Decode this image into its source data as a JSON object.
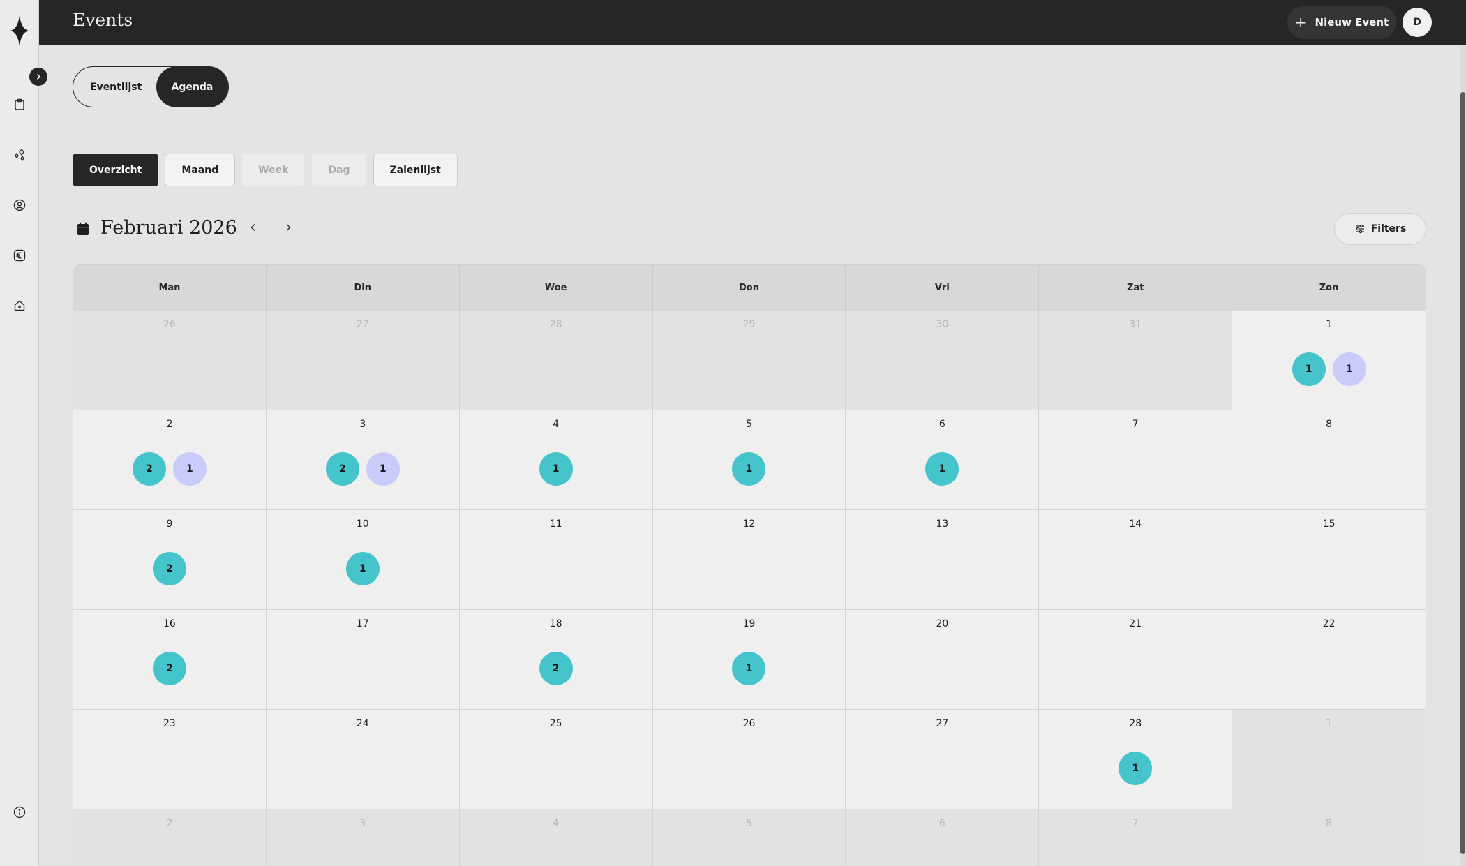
{
  "app": {
    "title": "Events"
  },
  "header": {
    "new_event_label": "Nieuw Event",
    "avatar_initial": "D"
  },
  "sidebar": {
    "items": [
      {
        "icon": "clipboard-icon"
      },
      {
        "icon": "sparkle-diamonds-icon"
      },
      {
        "icon": "user-circle-icon"
      },
      {
        "icon": "euro-icon"
      },
      {
        "icon": "home-icon"
      }
    ],
    "footer_icon": "info-icon"
  },
  "view_toggle": {
    "options": [
      "Eventlijst",
      "Agenda"
    ],
    "active": "Agenda"
  },
  "view_tabs": [
    {
      "label": "Overzicht",
      "state": "active"
    },
    {
      "label": "Maand",
      "state": "normal"
    },
    {
      "label": "Week",
      "state": "disabled"
    },
    {
      "label": "Dag",
      "state": "disabled"
    },
    {
      "label": "Zalenlijst",
      "state": "normal"
    }
  ],
  "calendar": {
    "month_label": "Februari 2026",
    "filters_label": "Filters",
    "weekdays": [
      "Man",
      "Din",
      "Woe",
      "Don",
      "Vri",
      "Zat",
      "Zon"
    ],
    "colors": {
      "teal": "#45c4cb",
      "lavender": "#c9cbf8"
    },
    "weeks": [
      [
        {
          "day": "26",
          "outside": true,
          "badges": []
        },
        {
          "day": "27",
          "outside": true,
          "badges": []
        },
        {
          "day": "28",
          "outside": true,
          "badges": []
        },
        {
          "day": "29",
          "outside": true,
          "badges": []
        },
        {
          "day": "30",
          "outside": true,
          "badges": []
        },
        {
          "day": "31",
          "outside": true,
          "badges": []
        },
        {
          "day": "1",
          "outside": false,
          "badges": [
            {
              "count": "1",
              "color": "teal"
            },
            {
              "count": "1",
              "color": "lavender"
            }
          ]
        }
      ],
      [
        {
          "day": "2",
          "outside": false,
          "badges": [
            {
              "count": "2",
              "color": "teal"
            },
            {
              "count": "1",
              "color": "lavender"
            }
          ]
        },
        {
          "day": "3",
          "outside": false,
          "badges": [
            {
              "count": "2",
              "color": "teal"
            },
            {
              "count": "1",
              "color": "lavender"
            }
          ]
        },
        {
          "day": "4",
          "outside": false,
          "badges": [
            {
              "count": "1",
              "color": "teal"
            }
          ]
        },
        {
          "day": "5",
          "outside": false,
          "badges": [
            {
              "count": "1",
              "color": "teal"
            }
          ]
        },
        {
          "day": "6",
          "outside": false,
          "badges": [
            {
              "count": "1",
              "color": "teal"
            }
          ]
        },
        {
          "day": "7",
          "outside": false,
          "badges": []
        },
        {
          "day": "8",
          "outside": false,
          "badges": []
        }
      ],
      [
        {
          "day": "9",
          "outside": false,
          "badges": [
            {
              "count": "2",
              "color": "teal"
            }
          ]
        },
        {
          "day": "10",
          "outside": false,
          "badges": [
            {
              "count": "1",
              "color": "teal"
            }
          ]
        },
        {
          "day": "11",
          "outside": false,
          "badges": []
        },
        {
          "day": "12",
          "outside": false,
          "badges": []
        },
        {
          "day": "13",
          "outside": false,
          "badges": []
        },
        {
          "day": "14",
          "outside": false,
          "badges": []
        },
        {
          "day": "15",
          "outside": false,
          "badges": []
        }
      ],
      [
        {
          "day": "16",
          "outside": false,
          "badges": [
            {
              "count": "2",
              "color": "teal"
            }
          ]
        },
        {
          "day": "17",
          "outside": false,
          "badges": []
        },
        {
          "day": "18",
          "outside": false,
          "badges": [
            {
              "count": "2",
              "color": "teal"
            }
          ]
        },
        {
          "day": "19",
          "outside": false,
          "badges": [
            {
              "count": "1",
              "color": "teal"
            }
          ]
        },
        {
          "day": "20",
          "outside": false,
          "badges": []
        },
        {
          "day": "21",
          "outside": false,
          "badges": []
        },
        {
          "day": "22",
          "outside": false,
          "badges": []
        }
      ],
      [
        {
          "day": "23",
          "outside": false,
          "badges": []
        },
        {
          "day": "24",
          "outside": false,
          "badges": []
        },
        {
          "day": "25",
          "outside": false,
          "badges": []
        },
        {
          "day": "26",
          "outside": false,
          "badges": []
        },
        {
          "day": "27",
          "outside": false,
          "badges": []
        },
        {
          "day": "28",
          "outside": false,
          "badges": [
            {
              "count": "1",
              "color": "teal"
            }
          ]
        },
        {
          "day": "1",
          "outside": true,
          "badges": []
        }
      ],
      [
        {
          "day": "2",
          "outside": true,
          "badges": []
        },
        {
          "day": "3",
          "outside": true,
          "badges": []
        },
        {
          "day": "4",
          "outside": true,
          "badges": []
        },
        {
          "day": "5",
          "outside": true,
          "badges": []
        },
        {
          "day": "6",
          "outside": true,
          "badges": []
        },
        {
          "day": "7",
          "outside": true,
          "badges": []
        },
        {
          "day": "8",
          "outside": true,
          "badges": []
        }
      ]
    ]
  }
}
